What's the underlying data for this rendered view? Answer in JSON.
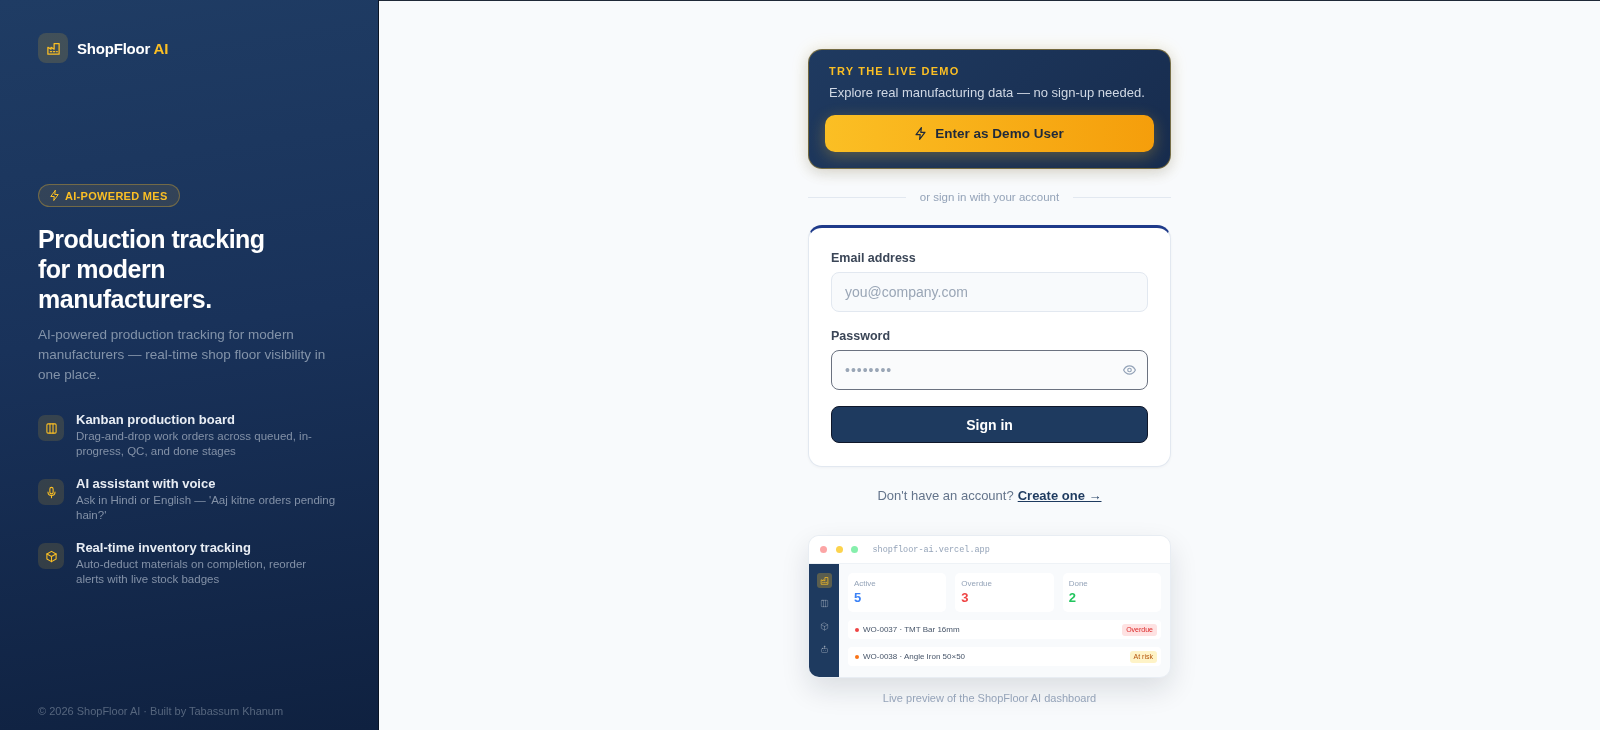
{
  "brand": {
    "name": "ShopFloor",
    "accent": "AI"
  },
  "badge": {
    "label": "AI-POWERED MES"
  },
  "headline": "Production tracking for modern manufacturers.",
  "description": "AI-powered production tracking for modern manufacturers — real-time shop floor visibility in one place.",
  "features": [
    {
      "title": "Kanban production board",
      "description": "Drag-and-drop work orders across queued, in-progress, QC, and done stages"
    },
    {
      "title": "AI assistant with voice",
      "description": "Ask in Hindi or English — 'Aaj kitne orders pending hain?'"
    },
    {
      "title": "Real-time inventory tracking",
      "description": "Auto-deduct materials on completion, reorder alerts with live stock badges"
    }
  ],
  "footer": "© 2026 ShopFloor AI · Built by Tabassum Khanum",
  "demo": {
    "eyebrow": "TRY THE LIVE DEMO",
    "subtitle": "Explore real manufacturing data — no sign-up needed.",
    "button": "Enter as Demo User"
  },
  "divider": "or sign in with your account",
  "form": {
    "fields": [
      {
        "kind": "email",
        "label": "Email address",
        "placeholder": "you@company.com",
        "focused": false
      },
      {
        "kind": "password",
        "label": "Password",
        "placeholder": "••••••••",
        "focused": true
      }
    ],
    "submit": "Sign in"
  },
  "signup": {
    "prompt": "Don't have an account?",
    "link": "Create one →"
  },
  "preview": {
    "url": "shopfloor-ai.vercel.app",
    "sidebar": [
      {
        "selected": true
      },
      {
        "selected": false
      },
      {
        "selected": false
      },
      {
        "selected": false
      }
    ],
    "stats": [
      {
        "label": "Active",
        "value": "5",
        "color": "#3b82f6"
      },
      {
        "label": "Overdue",
        "value": "3",
        "color": "#ef4444"
      },
      {
        "label": "Done",
        "value": "2",
        "color": "#22c55e"
      }
    ],
    "orders": [
      {
        "text": "WO-0037 · TMT Bar 16mm",
        "color": "#ef4444",
        "kind": "overdue",
        "badge": "Overdue"
      },
      {
        "text": "WO-0038 · Angle Iron 50×50",
        "color": "#f97316",
        "kind": "at_risk",
        "badge": "At risk"
      }
    ],
    "caption": "Live preview of the ShopFloor AI dashboard"
  }
}
